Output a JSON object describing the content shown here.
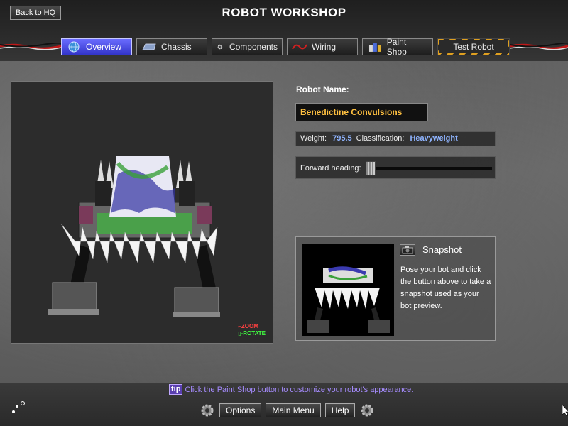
{
  "header": {
    "back_label": "Back to HQ",
    "title": "ROBOT WORKSHOP"
  },
  "tabs": [
    {
      "label": "Overview",
      "icon": "globe-icon",
      "active": true
    },
    {
      "label": "Chassis",
      "icon": "chassis-icon",
      "active": false
    },
    {
      "label": "Components",
      "icon": "gear-icon",
      "active": false
    },
    {
      "label": "Wiring",
      "icon": "wire-icon",
      "active": false
    },
    {
      "label": "Paint Shop",
      "icon": "paint-icon",
      "active": false
    },
    {
      "label": "Test Robot",
      "icon": "",
      "active": false
    }
  ],
  "viewport": {
    "zoom_label": "ZOOM",
    "rotate_label": "ROTATE"
  },
  "robot": {
    "name_label": "Robot Name:",
    "name_value": "Benedictine Convulsions",
    "weight_label": "Weight:",
    "weight_value": "795.5",
    "class_label": "Classification:",
    "class_value": "Heavyweight",
    "heading_label": "Forward heading:",
    "heading_value": 0.0
  },
  "snapshot": {
    "title": "Snapshot",
    "text": "Pose your bot and click the button above to take a snapshot used as your bot preview."
  },
  "footer": {
    "tip_badge": "tip",
    "tip_text": "Click the Paint Shop button to customize your robot's appearance.",
    "options_label": "Options",
    "main_menu_label": "Main Menu",
    "help_label": "Help"
  },
  "colors": {
    "accent_blue": "#4648e0",
    "name_text": "#ffc040",
    "value_blue": "#8fb4ff",
    "tip_purple": "#a68cff"
  }
}
